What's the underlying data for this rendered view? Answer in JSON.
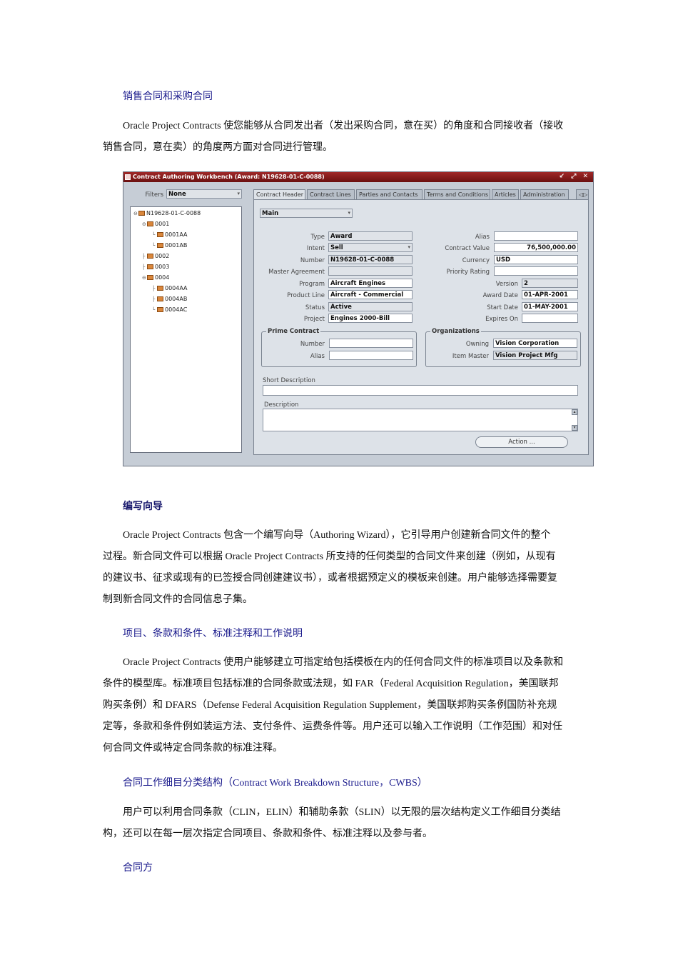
{
  "headings": {
    "h1": "销售合同和采购合同",
    "h2": "编写向导",
    "h3": "项目、条款和条件、标准注释和工作说明",
    "h4": "合同工作细目分类结构（Contract Work Breakdown Structure，CWBS）",
    "h5": "合同方"
  },
  "paragraphs": {
    "p1": [
      "Oracle Project Contracts 使您能够从合同发出者（发出采购合同，意在买）的角度和合同接收者（接收",
      "销售合同，意在卖）的角度两方面对合同进行管理。"
    ],
    "p2": [
      "Oracle Project Contracts 包含一个编写向导（Authoring Wizard），它引导用户创建新合同文件的整个",
      "过程。新合同文件可以根据 Oracle Project Contracts 所支持的任何类型的合同文件来创建（例如，从现有",
      "的建议书、征求或现有的已签授合同创建建议书），或者根据预定义的模板来创建。用户能够选择需要复",
      "制到新合同文件的合同信息子集。"
    ],
    "p3": [
      "Oracle Project Contracts 使用户能够建立可指定给包括模板在内的任何合同文件的标准项目以及条款和",
      "条件的模型库。标准项目包括标准的合同条款或法规，如 FAR（Federal Acquisition Regulation，美国联邦",
      "购买条例）和 DFARS（Defense Federal Acquisition Regulation Supplement，美国联邦购买条例国防补充规",
      "定等，条款和条件例如装运方法、支付条件、运费条件等。用户还可以输入工作说明（工作范围）和对任",
      "何合同文件或特定合同条款的标准注释。"
    ],
    "p4": [
      "用户可以利用合同条款（CLIN，ELIN）和辅助条款（SLIN）以无限的层次结构定义工作细目分类结",
      "构，还可以在每一层次指定合同项目、条款和条件、标准注释以及参与者。"
    ]
  },
  "screenshot": {
    "title": "Contract Authoring Workbench (Award: N19628-01-C-0088)",
    "window_controls": "↙ ⤢ ✕",
    "filters_label": "Filters",
    "filters_value": "None",
    "tree": {
      "root": "N19628-01-C-0088",
      "l0001": "0001",
      "l0001AA": "0001AA",
      "l0001AB": "0001AB",
      "l0002": "0002",
      "l0003": "0003",
      "l0004": "0004",
      "l0004AA": "0004AA",
      "l0004AB": "0004AB",
      "l0004AC": "0004AC"
    },
    "tabs": {
      "t1": "Contract Header",
      "t2": "Contract Lines",
      "t3": "Parties and Contacts",
      "t4": "Terms and Conditions",
      "t5": "Articles",
      "t6": "Administration",
      "more": "◁▷"
    },
    "section_select": "Main",
    "labels": {
      "type": "Type",
      "intent": "Intent",
      "number": "Number",
      "master_agreement": "Master Agreement",
      "program": "Program",
      "product_line": "Product Line",
      "status": "Status",
      "project": "Project",
      "alias": "Alias",
      "contract_value": "Contract Value",
      "currency": "Currency",
      "priority_rating": "Priority Rating",
      "version": "Version",
      "award_date": "Award Date",
      "start_date": "Start Date",
      "expires_on": "Expires On",
      "prime_contract": "Prime Contract",
      "pc_number": "Number",
      "pc_alias": "Alias",
      "organizations": "Organizations",
      "owning": "Owning",
      "item_master": "Item Master",
      "short_description": "Short Description",
      "description": "Description"
    },
    "values": {
      "type": "Award",
      "intent": "Sell",
      "number": "N19628-01-C-0088",
      "master_agreement": "",
      "program": "Aircraft Engines",
      "product_line": "Aircraft - Commercial",
      "status": "Active",
      "project": "Engines 2000-Bill",
      "alias": "",
      "contract_value": "76,500,000.00",
      "currency": "USD",
      "priority_rating": "",
      "version": "2",
      "award_date": "01-APR-2001",
      "start_date": "01-MAY-2001",
      "expires_on": "",
      "owning": "Vision Corporation",
      "item_master": "Vision Project Mfg"
    },
    "action_button": "Action ..."
  }
}
